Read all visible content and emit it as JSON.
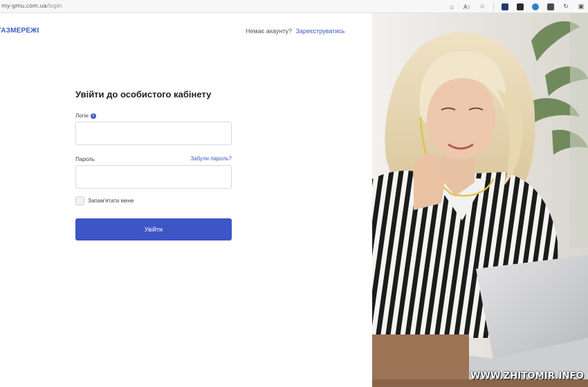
{
  "browser": {
    "url_host": "my-gmu.com.ua",
    "url_path": "/login",
    "icons": [
      "key-icon",
      "read-aloud-icon",
      "favorite-star-icon",
      "extension-icon",
      "extension-icon",
      "extension-icon",
      "extension-icon",
      "refresh-icon",
      "profile-icon"
    ]
  },
  "header": {
    "brand": "ГАЗМЕРЕЖІ",
    "no_account_text": "Немає акаунту?",
    "register_link": "Зареєструватись"
  },
  "form": {
    "title": "Увійти до особистого кабінету",
    "login_label": "Логін",
    "login_value": "",
    "password_label": "Пароль",
    "password_value": "",
    "forgot_password": "Забули пароль?",
    "remember_me": "Запам'ятати мене",
    "remember_checked": false,
    "submit": "Увійти"
  },
  "colors": {
    "accent": "#3d55c6",
    "link": "#3d5bbf"
  },
  "watermark": "WWW.ZHITOMIR.INFO"
}
